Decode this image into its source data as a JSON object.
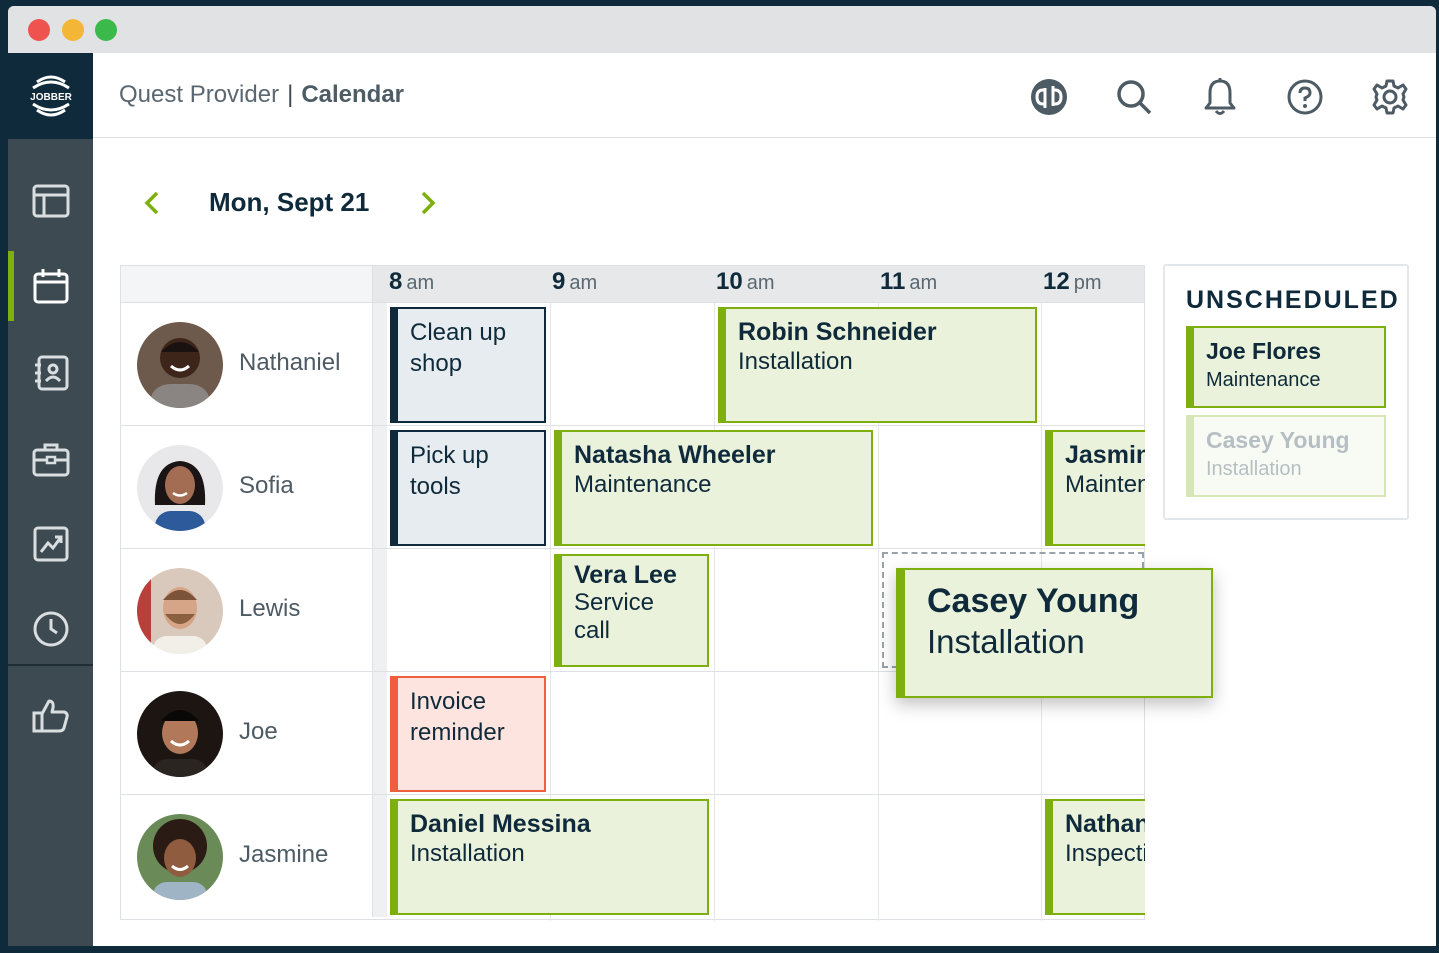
{
  "header": {
    "account": "Quest Provider",
    "separator": "|",
    "page": "Calendar",
    "logo_text": "JOBBER"
  },
  "date_nav": {
    "date": "Mon, Sept 21"
  },
  "hours": [
    {
      "num": "8",
      "suffix": "am"
    },
    {
      "num": "9",
      "suffix": "am"
    },
    {
      "num": "10",
      "suffix": "am"
    },
    {
      "num": "11",
      "suffix": "am"
    },
    {
      "num": "12",
      "suffix": "pm"
    }
  ],
  "people": [
    "Nathaniel",
    "Sofia",
    "Lewis",
    "Joe",
    "Jasmine"
  ],
  "jobs": {
    "clean_up": {
      "title": "Clean up shop"
    },
    "robin": {
      "name": "Robin Schneider",
      "type": "Installation"
    },
    "pick_up": {
      "title": "Pick up tools"
    },
    "natasha": {
      "name": "Natasha Wheeler",
      "type": "Maintenance"
    },
    "jasmine_job": {
      "name": "Jasmine",
      "type": "Maintenance"
    },
    "vera": {
      "name": "Vera Lee",
      "type": "Service call"
    },
    "invoice": {
      "title": "Invoice reminder"
    },
    "daniel": {
      "name": "Daniel Messina",
      "type": "Installation"
    },
    "nathan_job": {
      "name": "Nathan",
      "type": "Inspection"
    },
    "casey_drag": {
      "name": "Casey Young",
      "type": "Installation"
    }
  },
  "unscheduled": {
    "heading": "UNSCHEDULED",
    "items": [
      {
        "name": "Joe Flores",
        "type": "Maintenance"
      },
      {
        "name": "Casey Young",
        "type": "Installation"
      }
    ]
  },
  "colors": {
    "brand_dark": "#0f2a3a",
    "accent_green": "#7db00e",
    "alert_red": "#ef5e3f"
  }
}
